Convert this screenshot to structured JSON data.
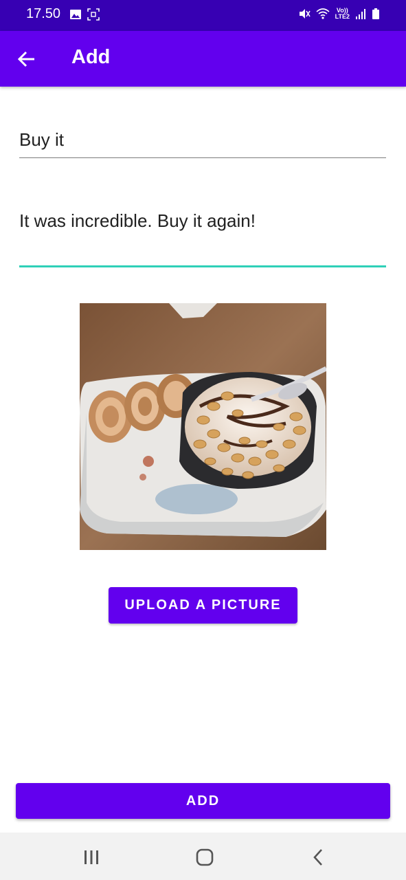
{
  "status_bar": {
    "time": "17.50",
    "left_icons": [
      "gallery-icon",
      "screenshot-icon"
    ],
    "right_icons": [
      "mute-icon",
      "wifi-icon",
      "volte-icon",
      "signal-icon",
      "battery-icon"
    ],
    "network_line1": "Vo))",
    "network_line2": "LTE2"
  },
  "app_bar": {
    "title": "Add",
    "back_icon": "arrow-back-icon"
  },
  "form": {
    "title_value": "Buy it",
    "description_value": "It was incredible. Buy it again!"
  },
  "image": {
    "alt": "dessert with ice cream, peanuts and swiss roll"
  },
  "buttons": {
    "upload_label": "UPLOAD A PICTURE",
    "add_label": "ADD"
  },
  "colors": {
    "primary": "#6200ee",
    "primary_dark": "#3700b3",
    "accent": "#2fd0b8"
  },
  "nav_bar": {
    "icons": [
      "recents-icon",
      "home-icon",
      "back-icon"
    ]
  }
}
